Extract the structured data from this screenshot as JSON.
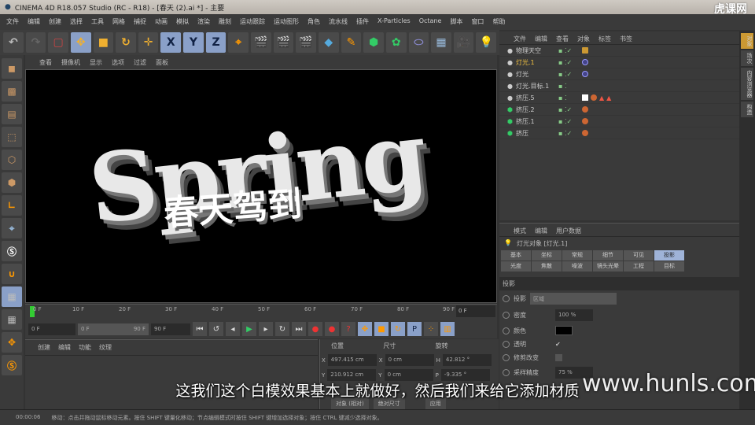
{
  "title": "CINEMA 4D R18.057 Studio (RC - R18) - [春天 (2).ai *] - 主要",
  "logo": "虎课网",
  "menu": [
    "文件",
    "编辑",
    "创建",
    "选择",
    "工具",
    "网格",
    "捕捉",
    "动画",
    "模拟",
    "渲染",
    "雕刻",
    "运动跟踪",
    "运动图形",
    "角色",
    "流水线",
    "插件",
    "X-Particles",
    "Octane",
    "脚本",
    "窗口",
    "帮助"
  ],
  "toolbar": [
    "↶",
    "↷",
    "▢",
    "✥",
    "■",
    "↻",
    "✛",
    "X",
    "Y",
    "Z",
    "⌖",
    "🎬",
    "🎬",
    "🎬",
    "◆",
    "✎",
    "⬢",
    "✿",
    "⬭",
    "▦",
    "🎥",
    "💡"
  ],
  "viewport": {
    "menu": [
      "查看",
      "摄像机",
      "显示",
      "选项",
      "过滤",
      "面板"
    ],
    "text_main": "Spring",
    "text_cn": "春天驾到"
  },
  "timeline": {
    "ticks": [
      "0 F",
      "10 F",
      "20 F",
      "30 F",
      "40 F",
      "50 F",
      "60 F",
      "70 F",
      "80 F",
      "90 F"
    ],
    "current": "0 F",
    "start": "0 F",
    "range_start": "0 F",
    "range_end": "90 F",
    "end": "90 F"
  },
  "material_manager": {
    "menu": [
      "创建",
      "编辑",
      "功能",
      "纹理"
    ]
  },
  "coordinates": {
    "headers": [
      "位置",
      "尺寸",
      "旋转"
    ],
    "rows": [
      {
        "a": "X",
        "pos": "497.415 cm",
        "b": "X",
        "size": "0 cm",
        "c": "H",
        "rot": "42.812 °"
      },
      {
        "a": "Y",
        "pos": "210.912 cm",
        "b": "Y",
        "size": "0 cm",
        "c": "P",
        "rot": "-9.335 °"
      }
    ],
    "mode": "对象 (相对)",
    "size_mode": "绝对尺寸",
    "apply": "应用"
  },
  "object_manager": {
    "menu": [
      "文件",
      "编辑",
      "查看",
      "对象",
      "标签",
      "书签"
    ],
    "objects": [
      {
        "name": "物理天空",
        "color": "#ccc"
      },
      {
        "name": "灯光.1",
        "color": "#f0c040"
      },
      {
        "name": "灯光",
        "color": "#ccc"
      },
      {
        "name": "灯光.目标.1",
        "color": "#ccc"
      },
      {
        "name": "挤压.5",
        "color": "#ccc"
      },
      {
        "name": "挤压.2",
        "color": "#ccc"
      },
      {
        "name": "挤压.1",
        "color": "#ccc"
      },
      {
        "name": "挤压",
        "color": "#ccc"
      }
    ]
  },
  "right_tabs": [
    "对象",
    "场次",
    "内容浏览器",
    "构造"
  ],
  "attributes": {
    "menu": [
      "模式",
      "编辑",
      "用户数据"
    ],
    "title": "灯光对象 [灯光.1]",
    "tabs": [
      "基本",
      "坐标",
      "常规",
      "细节",
      "可见",
      "投影",
      "光度",
      "焦散",
      "噪波",
      "镜头光晕",
      "工程",
      "目标"
    ],
    "active_tab": "投影",
    "section": "投影",
    "shadow_type_label": "投影",
    "shadow_type": "区域",
    "density_label": "密度",
    "density": "100 %",
    "color_label": "颜色",
    "color": "#000000",
    "transparency_label": "透明",
    "transparency": "✔",
    "clip_label": "修剪改变",
    "sample_label": "采样精度",
    "sample": "75 %"
  },
  "status": {
    "time": "00:00:06",
    "message": "移动：点击并拖动鼠标移动元素。按住 SHIFT 键量化移动；节点编辑模式时按住 SHIFT 键增加选择对象；按住 CTRL 键减少选择对象。"
  },
  "subtitle": "这我们这个白模效果基本上就做好，然后我们来给它添加材质",
  "watermark": "www.hunls.com"
}
